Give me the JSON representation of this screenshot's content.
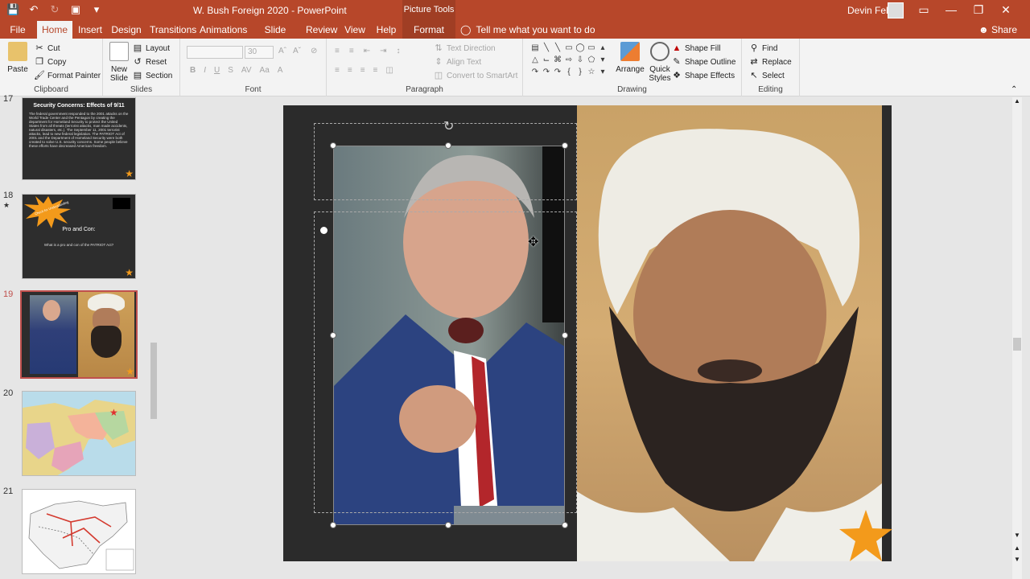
{
  "title_bar": {
    "doc_title": "W. Bush Foreign 2020  -  PowerPoint",
    "context_label": "Picture Tools",
    "user_name": "Devin Felts"
  },
  "tabs": [
    {
      "label": "File"
    },
    {
      "label": "Home"
    },
    {
      "label": "Insert"
    },
    {
      "label": "Design"
    },
    {
      "label": "Transitions"
    },
    {
      "label": "Animations"
    },
    {
      "label": "Slide Show"
    },
    {
      "label": "Review"
    },
    {
      "label": "View"
    },
    {
      "label": "Help"
    },
    {
      "label": "Format"
    }
  ],
  "tell_me": "Tell me what you want to do",
  "share": "Share",
  "ribbon": {
    "clipboard": {
      "paste": "Paste",
      "cut": "Cut",
      "copy": "Copy",
      "format_painter": "Format Painter",
      "label": "Clipboard"
    },
    "slides": {
      "new_slide": "New Slide",
      "layout": "Layout",
      "reset": "Reset",
      "section": "Section",
      "label": "Slides"
    },
    "font": {
      "size": "30",
      "label": "Font"
    },
    "paragraph": {
      "text_direction": "Text Direction",
      "align_text": "Align Text",
      "convert": "Convert to SmartArt",
      "label": "Paragraph"
    },
    "drawing": {
      "arrange": "Arrange",
      "quick_styles": "Quick Styles",
      "shape_fill": "Shape Fill",
      "shape_outline": "Shape Outline",
      "shape_effects": "Shape Effects",
      "label": "Drawing"
    },
    "editing": {
      "find": "Find",
      "replace": "Replace",
      "select": "Select",
      "label": "Editing"
    }
  },
  "thumbnails": [
    {
      "num": "17",
      "title": "Security Concerns:  Effects of 9/11",
      "body": "The federal government responded to the 2001 attacks on the World Trade Center and the Pentagon by creating the department for Homeland Security to protect the United States from all threats (terrorist attacks, man made accidents, natural disasters, etc.). The September 11, 2001 terrorist attacks, lead to new federal legislation. The PATRIOT Act of 2001 and the Department of Homeland Security were both created to solve U.S. security concerns. Some people believe these efforts have decreased American freedom."
    },
    {
      "num": "18",
      "title": "Pro and Con:",
      "body": "What is a pro and con of the PATRIOT Act?",
      "burst": "Check for Understanding"
    },
    {
      "num": "19"
    },
    {
      "num": "20"
    },
    {
      "num": "21"
    }
  ],
  "colors": {
    "accent": "#b7472a",
    "selected": "#c0504d",
    "star": "#f39a1b"
  }
}
